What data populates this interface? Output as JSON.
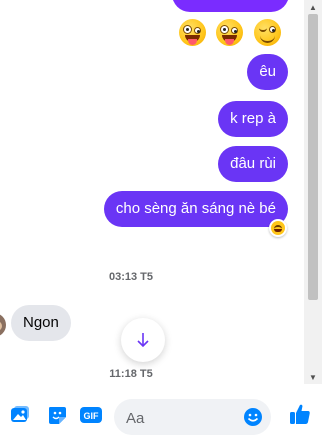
{
  "messages": {
    "outgoing_1": "êu",
    "outgoing_2": "k rep à",
    "outgoing_3": "đâu rùi",
    "outgoing_4": "cho sèng ăn sáng nè bé",
    "incoming_1": "Ngon"
  },
  "timestamps": {
    "first": "03:13 T5",
    "second": "11:18 T5"
  },
  "emojis_row": [
    "crazy-face-emoji",
    "crazy-face-emoji",
    "winking-face-emoji"
  ],
  "reaction_icon": "laughing-face-emoji",
  "composer": {
    "placeholder": "Aa",
    "icons": [
      "image-icon",
      "sticker-icon",
      "gif-icon",
      "emoji-icon",
      "thumbs-up-icon"
    ]
  },
  "colors": {
    "outgoing_bubble": "#6a35f5",
    "outgoing_top": "#7a2cff",
    "incoming_bubble": "#e4e6eb",
    "accent_blue": "#0084ff"
  }
}
